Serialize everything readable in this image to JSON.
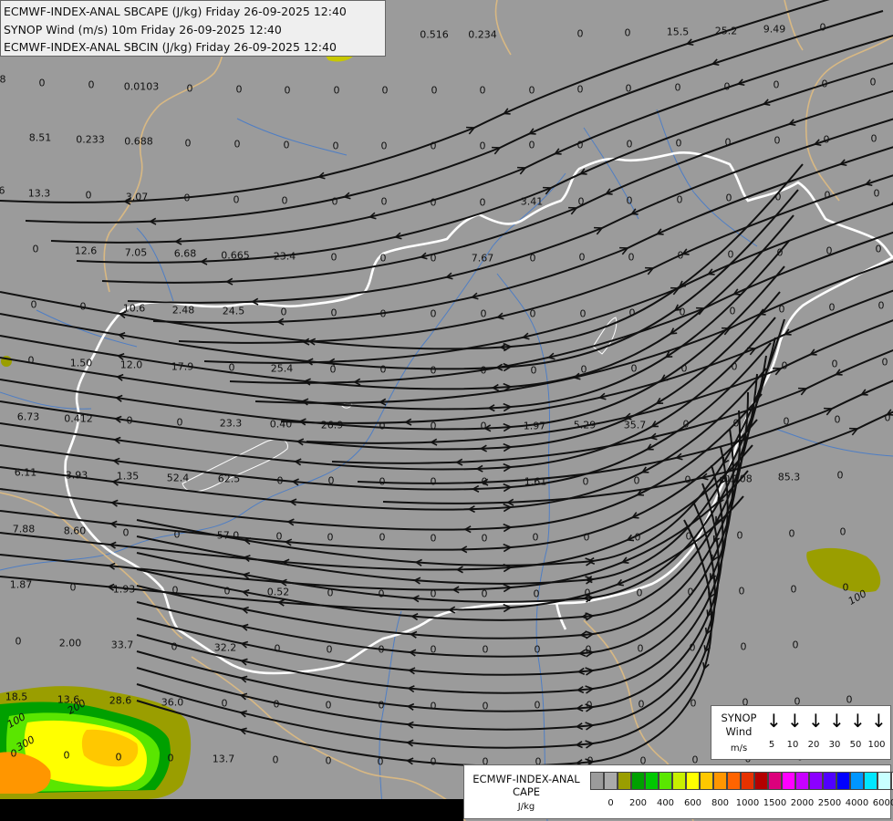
{
  "header": {
    "lines": [
      "ECMWF-INDEX-ANAL SBCAPE (J/kg) Friday 26-09-2025 12:40",
      "SYNOP Wind (m/s) 10m Friday 26-09-2025 12:40",
      "ECMWF-INDEX-ANAL SBCIN (J/kg) Friday 26-09-2025 12:40"
    ]
  },
  "colors": {
    "background": "#9b9b9b",
    "border": "#ffffff",
    "neighbor_borders": "#d8b883",
    "rivers": "#4f7ec4",
    "streamlines": "#111111"
  },
  "station_values": [
    [
      "0.516",
      476,
      38
    ],
    [
      "0.234",
      529,
      38
    ],
    [
      "0",
      636,
      37
    ],
    [
      "0",
      688,
      36
    ],
    [
      "15.5",
      743,
      35
    ],
    [
      "25.2",
      796,
      34
    ],
    [
      "9.49",
      849,
      32
    ],
    [
      "0",
      902,
      30
    ],
    [
      "8",
      3,
      87
    ],
    [
      "0",
      46,
      91
    ],
    [
      "0",
      100,
      93
    ],
    [
      "0.0103",
      155,
      95
    ],
    [
      "0",
      208,
      97
    ],
    [
      "0",
      262,
      98
    ],
    [
      "0",
      315,
      99
    ],
    [
      "0",
      369,
      99
    ],
    [
      "0",
      422,
      99
    ],
    [
      "0",
      476,
      99
    ],
    [
      "0",
      529,
      99
    ],
    [
      "0",
      583,
      99
    ],
    [
      "0",
      636,
      98
    ],
    [
      "0",
      689,
      97
    ],
    [
      "0",
      743,
      96
    ],
    [
      "0",
      797,
      95
    ],
    [
      "0",
      851,
      93
    ],
    [
      "0",
      904,
      92
    ],
    [
      "0",
      957,
      90
    ],
    [
      "8.51",
      44,
      151
    ],
    [
      "0.233",
      99,
      153
    ],
    [
      "0.688",
      152,
      155
    ],
    [
      "0",
      206,
      157
    ],
    [
      "0",
      260,
      158
    ],
    [
      "0",
      314,
      159
    ],
    [
      "0",
      368,
      160
    ],
    [
      "0",
      421,
      160
    ],
    [
      "0",
      475,
      160
    ],
    [
      "0",
      529,
      160
    ],
    [
      "0",
      583,
      159
    ],
    [
      "0",
      636,
      159
    ],
    [
      "0",
      690,
      158
    ],
    [
      "0",
      744,
      157
    ],
    [
      "0",
      798,
      156
    ],
    [
      "0",
      852,
      154
    ],
    [
      "0",
      906,
      153
    ],
    [
      "0",
      958,
      152
    ],
    [
      "6",
      2,
      209
    ],
    [
      "13.3",
      43,
      212
    ],
    [
      "0",
      97,
      214
    ],
    [
      "3.07",
      150,
      216
    ],
    [
      "0",
      205,
      217
    ],
    [
      "0",
      259,
      219
    ],
    [
      "0",
      312,
      220
    ],
    [
      "0",
      367,
      221
    ],
    [
      "0",
      421,
      221
    ],
    [
      "0",
      475,
      222
    ],
    [
      "0",
      529,
      222
    ],
    [
      "3.41",
      583,
      221
    ],
    [
      "0",
      637,
      221
    ],
    [
      "0",
      690,
      220
    ],
    [
      "0",
      745,
      219
    ],
    [
      "0",
      799,
      217
    ],
    [
      "0",
      853,
      216
    ],
    [
      "0",
      907,
      214
    ],
    [
      "0",
      961,
      212
    ],
    [
      "0",
      39,
      273
    ],
    [
      "12.6",
      94,
      275
    ],
    [
      "7.05",
      149,
      277
    ],
    [
      "6.68",
      203,
      278
    ],
    [
      "0.665",
      258,
      280
    ],
    [
      "23.4",
      312,
      281
    ],
    [
      "0",
      366,
      282
    ],
    [
      "0",
      420,
      283
    ],
    [
      "0",
      475,
      283
    ],
    [
      "7.67",
      529,
      283
    ],
    [
      "0",
      584,
      283
    ],
    [
      "0",
      638,
      282
    ],
    [
      "0",
      692,
      282
    ],
    [
      "0",
      746,
      280
    ],
    [
      "0",
      801,
      279
    ],
    [
      "0",
      855,
      277
    ],
    [
      "0",
      909,
      275
    ],
    [
      "0",
      963,
      273
    ],
    [
      "0",
      37,
      334
    ],
    [
      "0",
      91,
      336
    ],
    [
      "10.6",
      147,
      338
    ],
    [
      "2.48",
      201,
      340
    ],
    [
      "24.5",
      256,
      341
    ],
    [
      "0",
      311,
      342
    ],
    [
      "0",
      366,
      343
    ],
    [
      "0",
      420,
      344
    ],
    [
      "0",
      475,
      344
    ],
    [
      "0",
      530,
      344
    ],
    [
      "0",
      584,
      344
    ],
    [
      "0",
      639,
      344
    ],
    [
      "0",
      693,
      343
    ],
    [
      "0",
      748,
      342
    ],
    [
      "0",
      803,
      341
    ],
    [
      "0",
      857,
      339
    ],
    [
      "0",
      912,
      337
    ],
    [
      "0",
      966,
      335
    ],
    [
      "0",
      34,
      395
    ],
    [
      "1.50",
      89,
      398
    ],
    [
      "12.0",
      144,
      400
    ],
    [
      "17.9",
      200,
      402
    ],
    [
      "0",
      254,
      403
    ],
    [
      "25.4",
      309,
      404
    ],
    [
      "0",
      365,
      405
    ],
    [
      "0",
      420,
      405
    ],
    [
      "0",
      475,
      406
    ],
    [
      "0",
      530,
      406
    ],
    [
      "0",
      585,
      406
    ],
    [
      "0",
      640,
      405
    ],
    [
      "0",
      695,
      404
    ],
    [
      "0",
      750,
      404
    ],
    [
      "0",
      805,
      402
    ],
    [
      "0",
      860,
      401
    ],
    [
      "0",
      915,
      399
    ],
    [
      "0",
      970,
      397
    ],
    [
      "6.73",
      31,
      457
    ],
    [
      "0.412",
      86,
      459
    ],
    [
      "0",
      142,
      461
    ],
    [
      "0",
      197,
      463
    ],
    [
      "23.3",
      253,
      464
    ],
    [
      "0.40",
      308,
      465
    ],
    [
      "26.9",
      364,
      466
    ],
    [
      "0",
      419,
      467
    ],
    [
      "0",
      475,
      467
    ],
    [
      "0",
      530,
      467
    ],
    [
      "1.97",
      586,
      467
    ],
    [
      "5.29",
      641,
      466
    ],
    [
      "35.7",
      696,
      466
    ],
    [
      "0",
      752,
      465
    ],
    [
      "0",
      807,
      464
    ],
    [
      "0",
      862,
      462
    ],
    [
      "0",
      918,
      460
    ],
    [
      "0",
      973,
      458
    ],
    [
      "6.11",
      28,
      518
    ],
    [
      "3.93",
      84,
      521
    ],
    [
      "1.35",
      140,
      522
    ],
    [
      "52.4",
      195,
      524
    ],
    [
      "62.5",
      251,
      525
    ],
    [
      "0",
      307,
      527
    ],
    [
      "0",
      363,
      527
    ],
    [
      "0",
      419,
      528
    ],
    [
      "0",
      475,
      528
    ],
    [
      "0",
      531,
      528
    ],
    [
      "1.61",
      587,
      528
    ],
    [
      "0",
      642,
      528
    ],
    [
      "0",
      698,
      527
    ],
    [
      "0",
      754,
      526
    ],
    [
      "0.208",
      809,
      525
    ],
    [
      "85.3",
      865,
      523
    ],
    [
      "0",
      921,
      521
    ],
    [
      "7.88",
      26,
      580
    ],
    [
      "8.60",
      82,
      582
    ],
    [
      "0",
      138,
      584
    ],
    [
      "0",
      194,
      586
    ],
    [
      "57.0",
      250,
      587
    ],
    [
      "0",
      306,
      588
    ],
    [
      "0",
      362,
      589
    ],
    [
      "0",
      419,
      589
    ],
    [
      "0",
      475,
      590
    ],
    [
      "0",
      531,
      590
    ],
    [
      "0",
      587,
      589
    ],
    [
      "0",
      643,
      589
    ],
    [
      "0",
      699,
      589
    ],
    [
      "0",
      755,
      588
    ],
    [
      "0",
      811,
      587
    ],
    [
      "0",
      868,
      585
    ],
    [
      "0",
      924,
      583
    ],
    [
      "1.87",
      23,
      641
    ],
    [
      "0",
      80,
      644
    ],
    [
      "1.93",
      136,
      646
    ],
    [
      "0",
      192,
      647
    ],
    [
      "0",
      249,
      648
    ],
    [
      "0.52",
      305,
      649
    ],
    [
      "0",
      362,
      650
    ],
    [
      "0",
      418,
      651
    ],
    [
      "0",
      475,
      651
    ],
    [
      "0",
      531,
      651
    ],
    [
      "0",
      588,
      651
    ],
    [
      "0",
      644,
      650
    ],
    [
      "0",
      701,
      650
    ],
    [
      "0",
      757,
      649
    ],
    [
      "0",
      813,
      648
    ],
    [
      "0",
      870,
      646
    ],
    [
      "0",
      927,
      644
    ],
    [
      "0",
      20,
      703
    ],
    [
      "2.00",
      77,
      705
    ],
    [
      "33.7",
      134,
      707
    ],
    [
      "0",
      191,
      709
    ],
    [
      "32.2",
      247,
      710
    ],
    [
      "0",
      304,
      711
    ],
    [
      "0",
      361,
      712
    ],
    [
      "0",
      418,
      712
    ],
    [
      "0",
      475,
      712
    ],
    [
      "0",
      532,
      712
    ],
    [
      "0",
      589,
      712
    ],
    [
      "0",
      645,
      712
    ],
    [
      "0",
      702,
      711
    ],
    [
      "0",
      759,
      710
    ],
    [
      "0",
      815,
      709
    ],
    [
      "0",
      872,
      707
    ],
    [
      "18.5",
      18,
      764
    ],
    [
      "13.6",
      75,
      767
    ],
    [
      "28.6",
      132,
      768
    ],
    [
      "36.0",
      189,
      770
    ],
    [
      "0",
      246,
      771
    ],
    [
      "0",
      303,
      772
    ],
    [
      "0",
      360,
      773
    ],
    [
      "0",
      418,
      773
    ],
    [
      "0",
      475,
      774
    ],
    [
      "0",
      532,
      774
    ],
    [
      "0",
      589,
      773
    ],
    [
      "0",
      646,
      773
    ],
    [
      "0",
      703,
      772
    ],
    [
      "0",
      760,
      771
    ],
    [
      "0",
      817,
      770
    ],
    [
      "0",
      874,
      769
    ],
    [
      "0",
      931,
      767
    ],
    [
      "0",
      15,
      826
    ],
    [
      "0",
      73,
      828
    ],
    [
      "0",
      130,
      830
    ],
    [
      "0",
      187,
      831
    ],
    [
      "13.7",
      245,
      832
    ],
    [
      "0",
      302,
      833
    ],
    [
      "0",
      360,
      834
    ],
    [
      "0",
      417,
      835
    ],
    [
      "0",
      475,
      835
    ],
    [
      "0",
      532,
      835
    ],
    [
      "0",
      590,
      835
    ],
    [
      "0",
      647,
      834
    ],
    [
      "0",
      705,
      834
    ],
    [
      "0",
      762,
      833
    ],
    [
      "0",
      820,
      832
    ],
    [
      "0",
      877,
      830
    ],
    [
      "0",
      934,
      829
    ]
  ],
  "contour_labels": [
    [
      "100",
      18,
      790
    ],
    [
      "200",
      84,
      775
    ],
    [
      "300",
      28,
      815
    ],
    [
      "100",
      940,
      655
    ]
  ],
  "synop_legend": {
    "title_lines": [
      "SYNOP",
      "Wind"
    ],
    "unit": "m/s",
    "speeds": [
      "5",
      "10",
      "20",
      "30",
      "50",
      "100"
    ]
  },
  "cape_legend": {
    "title_lines": [
      "ECMWF-INDEX-ANAL",
      "CAPE"
    ],
    "unit": "J/kg",
    "colors": [
      "#9b9b9b",
      "#aaaaaa",
      "#9a9e00",
      "#00a000",
      "#00c800",
      "#5ae600",
      "#c8f000",
      "#ffff00",
      "#ffc800",
      "#ff9600",
      "#ff6400",
      "#e63200",
      "#b40000",
      "#dc007c",
      "#ff00ff",
      "#c800ff",
      "#8c00ff",
      "#5000ff",
      "#0000ff",
      "#0096ff",
      "#00e6ff",
      "#c8ffff",
      "#ffffff"
    ],
    "ticks": [
      "0",
      "200",
      "400",
      "600",
      "800",
      "1000",
      "1500",
      "2000",
      "2500",
      "4000",
      "6000"
    ]
  }
}
